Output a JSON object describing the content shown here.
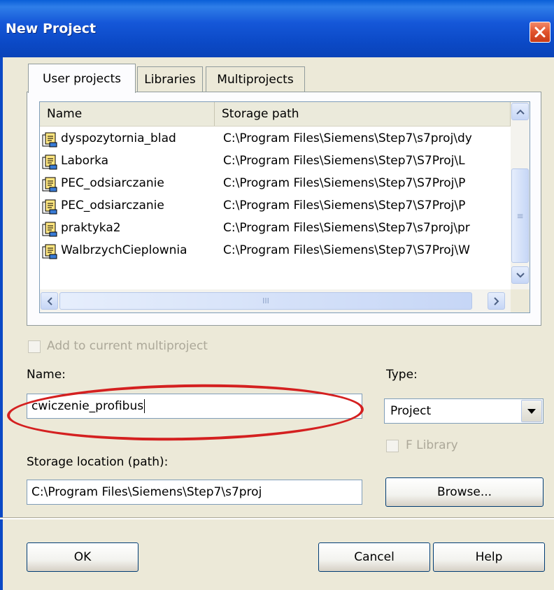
{
  "window": {
    "title": "New Project"
  },
  "tabs": [
    {
      "label": "User projects",
      "active": true
    },
    {
      "label": "Libraries",
      "active": false
    },
    {
      "label": "Multiprojects",
      "active": false
    }
  ],
  "list": {
    "columns": [
      "Name",
      "Storage path"
    ],
    "rows": [
      {
        "name": "dyspozytornia_blad",
        "path": "C:\\Program Files\\Siemens\\Step7\\s7proj\\dy"
      },
      {
        "name": "Laborka",
        "path": "C:\\Program Files\\Siemens\\Step7\\S7Proj\\L"
      },
      {
        "name": "PEC_odsiarczanie",
        "path": "C:\\Program Files\\Siemens\\Step7\\S7Proj\\P"
      },
      {
        "name": "PEC_odsiarczanie",
        "path": "C:\\Program Files\\Siemens\\Step7\\S7Proj\\P"
      },
      {
        "name": "praktyka2",
        "path": "C:\\Program Files\\Siemens\\Step7\\s7proj\\pr"
      },
      {
        "name": "WalbrzychCieplownia",
        "path": "C:\\Program Files\\Siemens\\Step7\\S7Proj\\W"
      }
    ],
    "hscroll_grip": "III",
    "vscroll_grip": "≡"
  },
  "form": {
    "add_to_multiproject_label": "Add to current multiproject",
    "name_label": "Name:",
    "name_value": "cwiczenie_profibus",
    "type_label": "Type:",
    "type_value": "Project",
    "f_library_label": "F Library",
    "storage_label": "Storage location (path):",
    "storage_value": "C:\\Program Files\\Siemens\\Step7\\s7proj",
    "browse_label": "Browse..."
  },
  "buttons": {
    "ok": "OK",
    "cancel": "Cancel",
    "help": "Help"
  },
  "colors": {
    "title_bar": "#0b49c6",
    "highlight_oval": "#d42020",
    "close_button": "#e0532c"
  },
  "icons": {
    "row_icon": "project-icon"
  }
}
